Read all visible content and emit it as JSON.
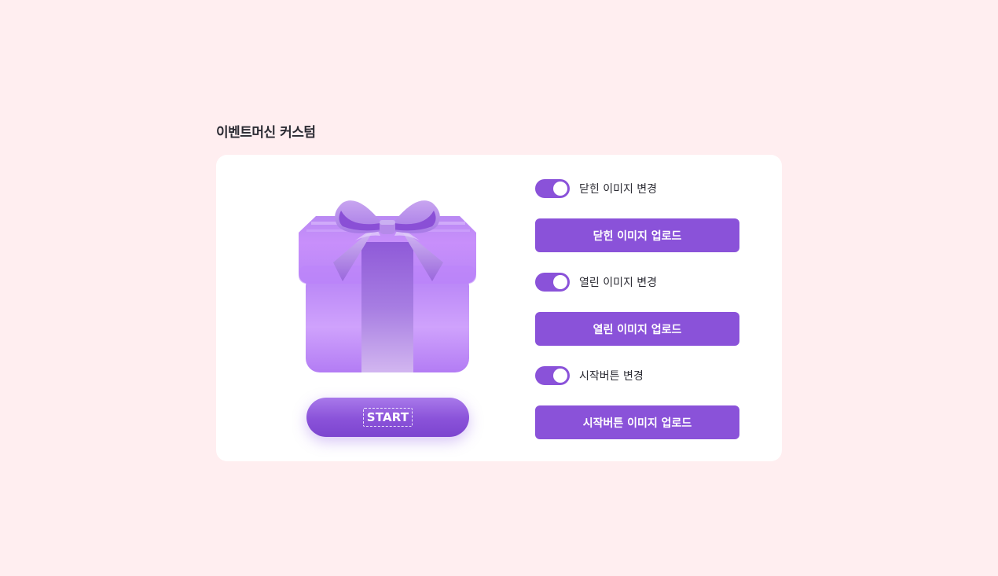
{
  "page": {
    "title": "이벤트머신 커스텀"
  },
  "preview": {
    "start_button_label": "START"
  },
  "settings": [
    {
      "toggle_label": "닫힌 이미지 변경",
      "toggle_on": true,
      "button_label": "닫힌 이미지 업로드"
    },
    {
      "toggle_label": "열린 이미지 변경",
      "toggle_on": true,
      "button_label": "열린 이미지 업로드"
    },
    {
      "toggle_label": "시작버튼 변경",
      "toggle_on": true,
      "button_label": "시작버튼 이미지 업로드"
    }
  ],
  "colors": {
    "background": "#ffeef0",
    "card": "#ffffff",
    "accent": "#8a52d9",
    "text": "#2b2b33"
  }
}
